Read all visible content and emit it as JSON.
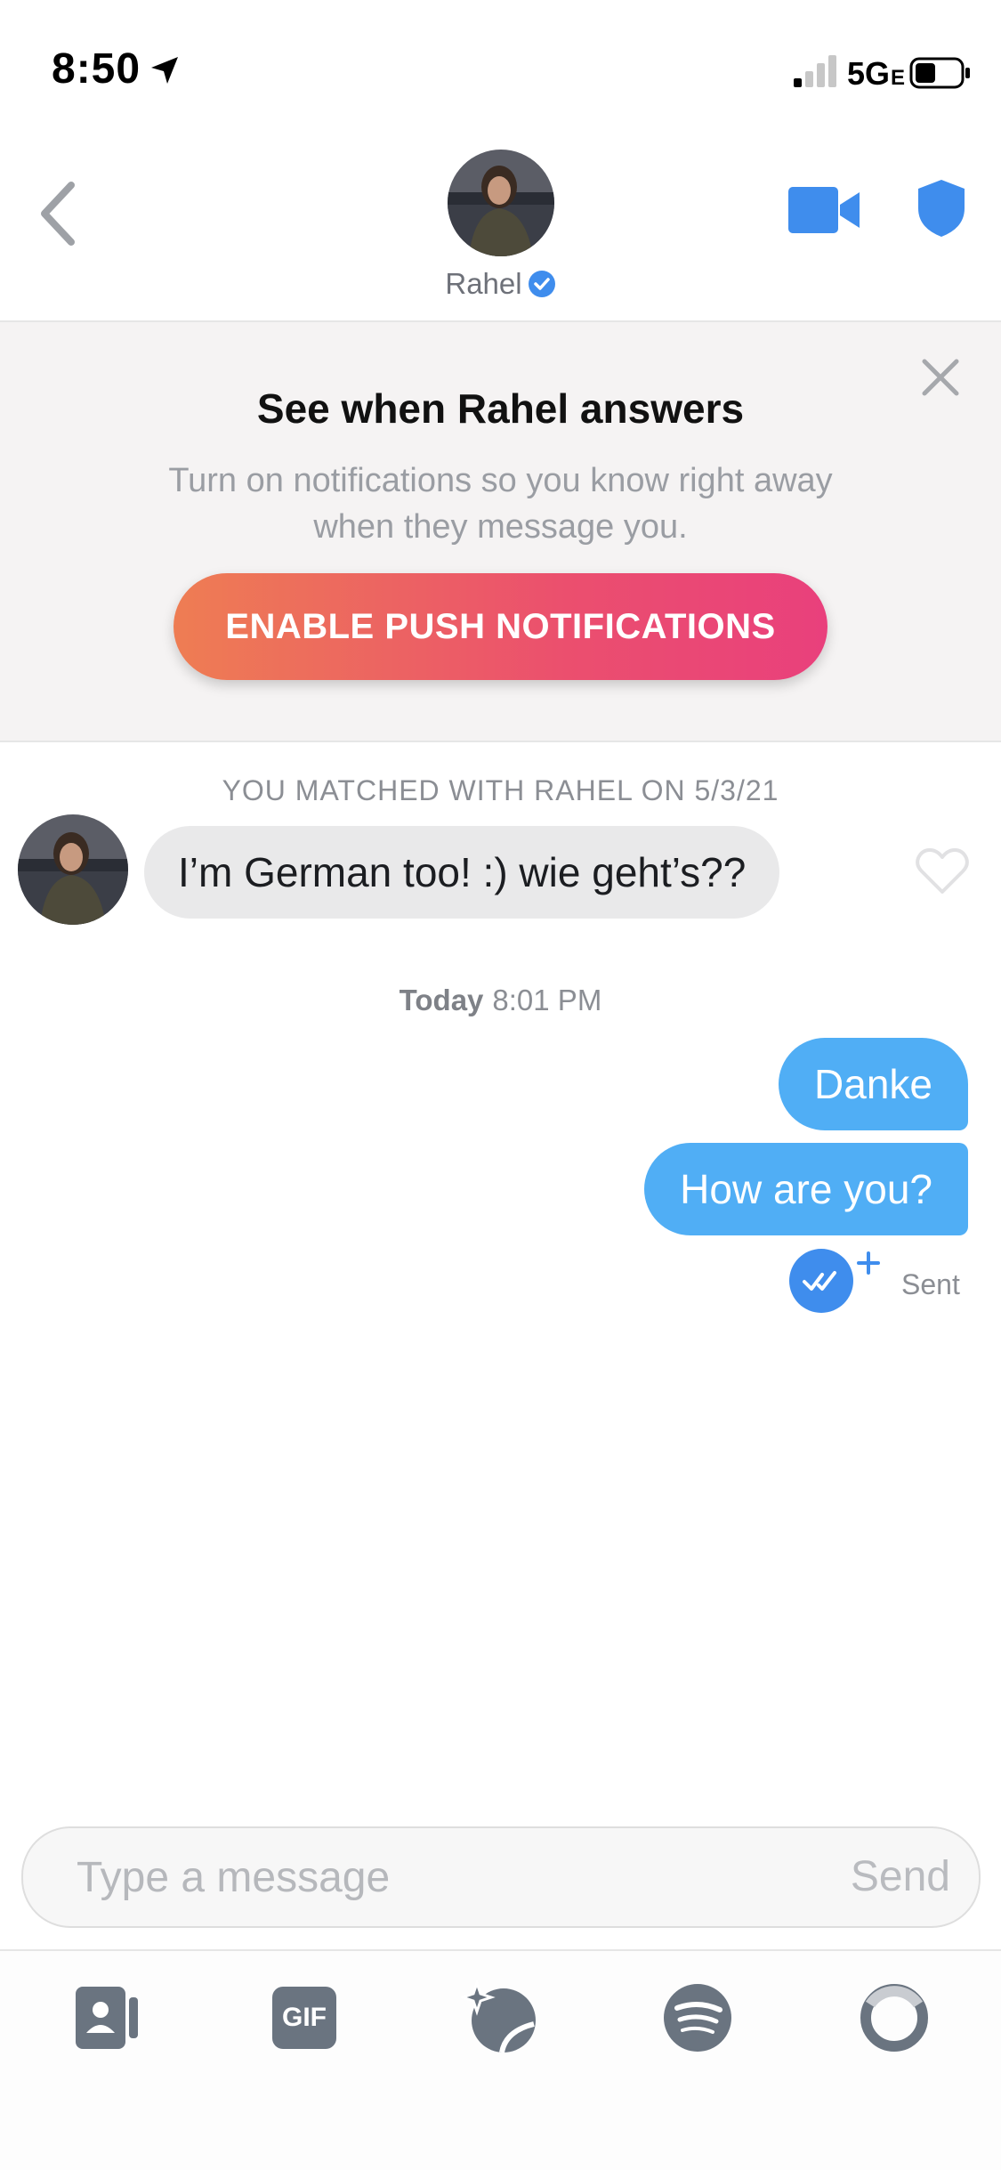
{
  "status_bar": {
    "time": "8:50",
    "network": "5G",
    "network_sub": "E"
  },
  "header": {
    "name": "Rahel"
  },
  "promo": {
    "title": "See when Rahel answers",
    "subtitle": "Turn on notifications so you know right away when they message you.",
    "button_label": "ENABLE PUSH NOTIFICATIONS"
  },
  "chat": {
    "matched_label": "YOU MATCHED WITH RAHEL ON 5/3/21",
    "incoming": [
      {
        "text": "I’m German too! :) wie geht’s??"
      }
    ],
    "timestamp_day": "Today",
    "timestamp_time": "8:01 PM",
    "outgoing": [
      {
        "text": "Danke"
      },
      {
        "text": "How are you?"
      }
    ],
    "delivery_status": "Sent"
  },
  "composer": {
    "placeholder": "Type a message",
    "send_label": "Send"
  },
  "toolbar": {
    "gif_label": "GIF"
  },
  "colors": {
    "accent_blue": "#50aef5",
    "icon_blue": "#3f8ded",
    "promo_gradient_start": "#ee7d53",
    "promo_gradient_end": "#e9407c"
  }
}
